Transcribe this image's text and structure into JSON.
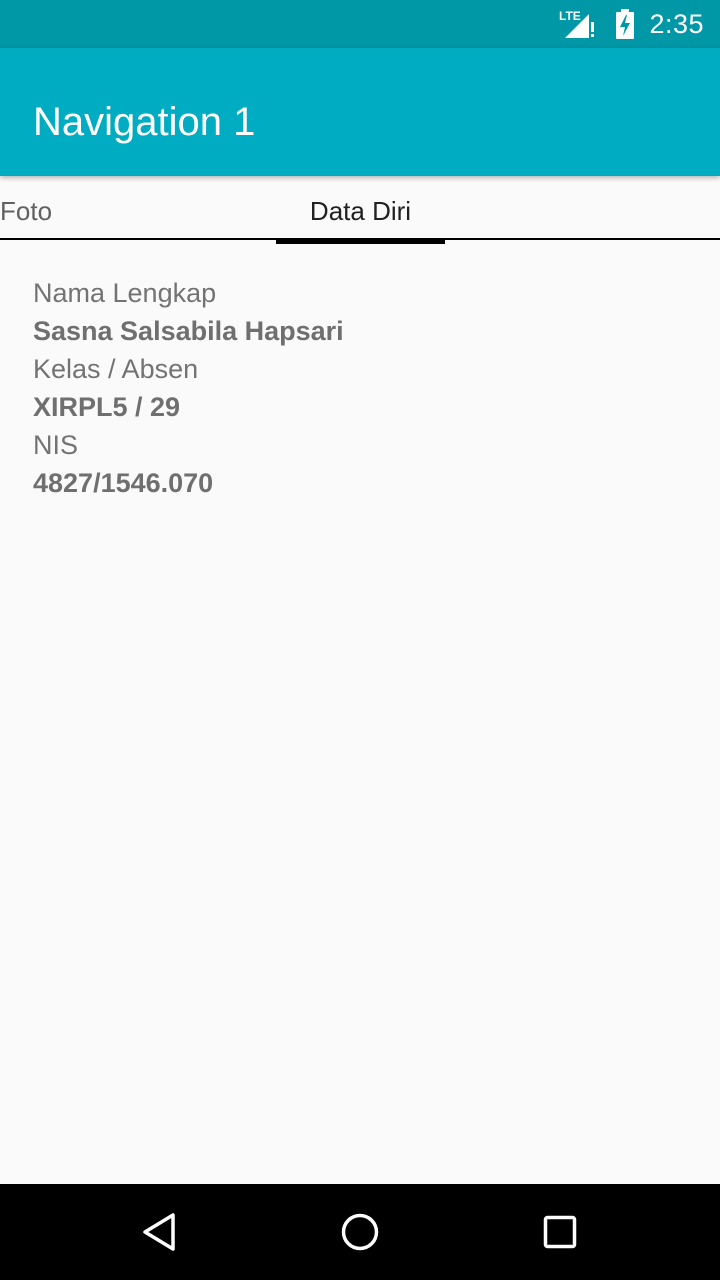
{
  "status_bar": {
    "network_label": "LTE",
    "time": "2:35",
    "icons": [
      "lte-signal-icon",
      "battery-charging-icon"
    ]
  },
  "app_bar": {
    "title": "Navigation 1",
    "color": "#00acc1"
  },
  "tabs": [
    {
      "label": "Foto",
      "selected": false
    },
    {
      "label": "Data Diri",
      "selected": true
    }
  ],
  "details": {
    "name_label": "Nama Lengkap",
    "name_value": "Sasna Salsabila Hapsari",
    "class_label": "Kelas / Absen",
    "class_value": "XIRPL5 / 29",
    "nis_label": "NIS",
    "nis_value": "4827/1546.070"
  },
  "nav_bar": {
    "icons": [
      "back-icon",
      "home-icon",
      "recents-icon"
    ]
  }
}
